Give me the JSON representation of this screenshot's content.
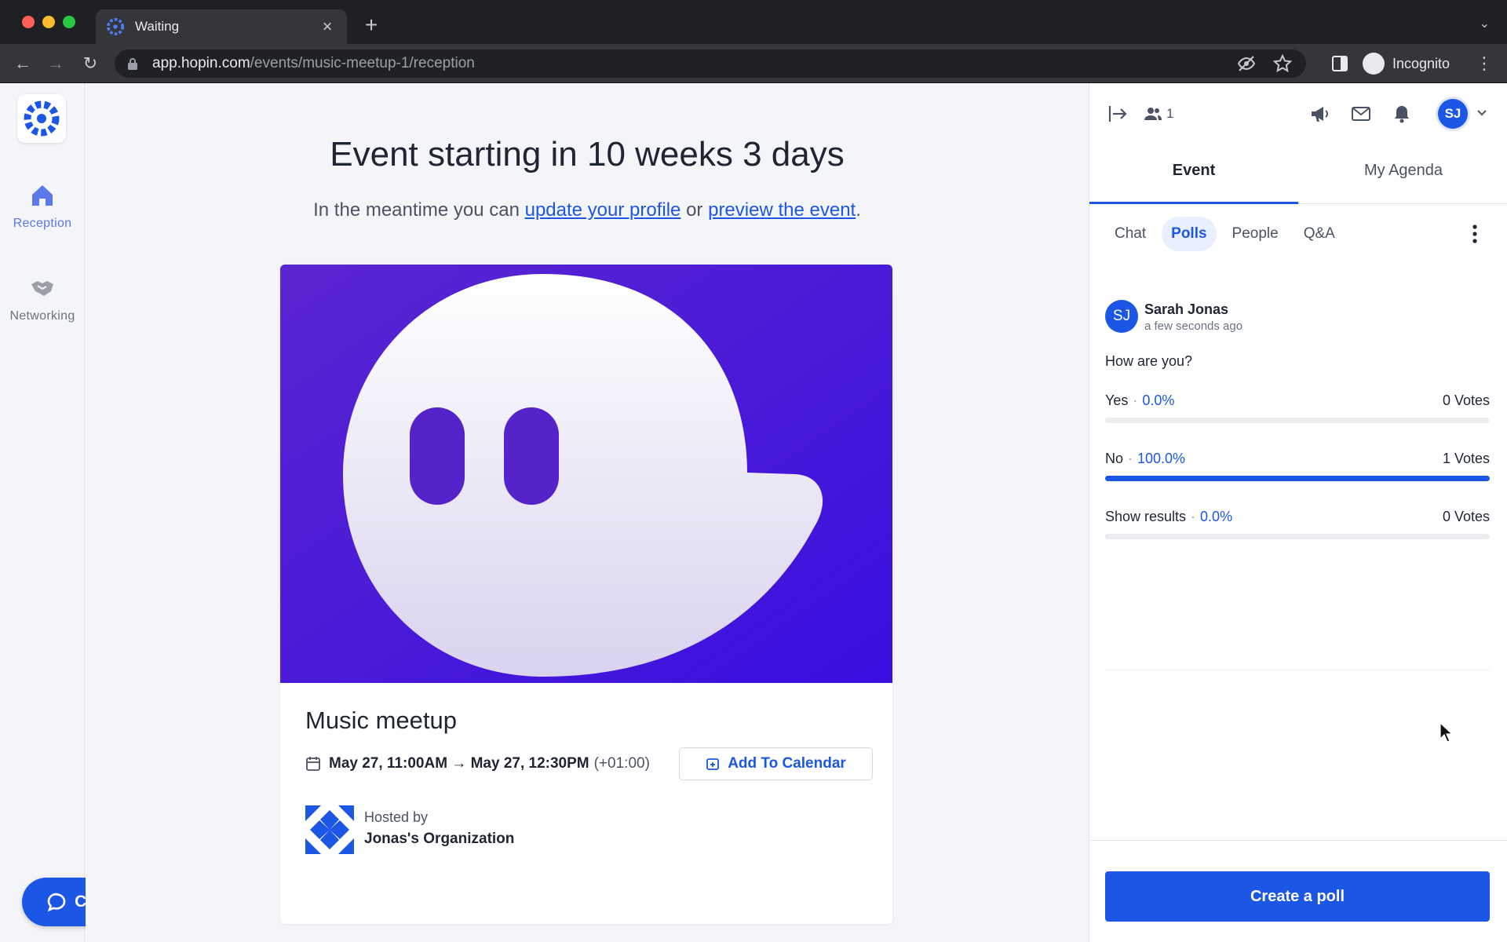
{
  "browser": {
    "tab_title": "Waiting",
    "url_host": "app.hopin.com",
    "url_path": "/events/music-meetup-1/reception",
    "profile_label": "Incognito"
  },
  "rail": {
    "items": [
      {
        "label": "Reception",
        "icon": "home-icon",
        "active": true
      },
      {
        "label": "Networking",
        "icon": "handshake-icon",
        "active": false
      }
    ],
    "chat_button": "Chat"
  },
  "main": {
    "countdown": "Event starting in 10 weeks 3 days",
    "sub_prefix": "In the meantime you can ",
    "link_profile": "update your profile",
    "sub_or": " or ",
    "link_preview": "preview the event",
    "sub_suffix": ".",
    "event": {
      "title": "Music meetup",
      "date_range": "May 27, 11:00AM → May 27, 12:30PM",
      "timezone": "(+01:00)",
      "add_calendar": "Add To Calendar",
      "hosted_by_label": "Hosted by",
      "host_name": "Jonas's Organization"
    }
  },
  "sidebar": {
    "people_count": "1",
    "avatar_initials": "SJ",
    "main_tabs": [
      "Event",
      "My Agenda"
    ],
    "sub_tabs": [
      "Chat",
      "Polls",
      "People",
      "Q&A"
    ],
    "active_sub_tab": "Polls",
    "poll": {
      "author_initials": "SJ",
      "author": "Sarah Jonas",
      "time": "a few seconds ago",
      "question": "How are you?",
      "options": [
        {
          "label": "Yes",
          "percent_text": "0.0%",
          "votes": "0 Votes",
          "fraction": 0.0
        },
        {
          "label": "No",
          "percent_text": "100.0%",
          "votes": "1 Votes",
          "fraction": 1.0
        },
        {
          "label": "Show results",
          "percent_text": "0.0%",
          "votes": "0 Votes",
          "fraction": 0.0
        }
      ]
    },
    "create_poll": "Create a poll"
  },
  "colors": {
    "accent": "#1c56e4",
    "banner_purple": "#4a17d6"
  }
}
